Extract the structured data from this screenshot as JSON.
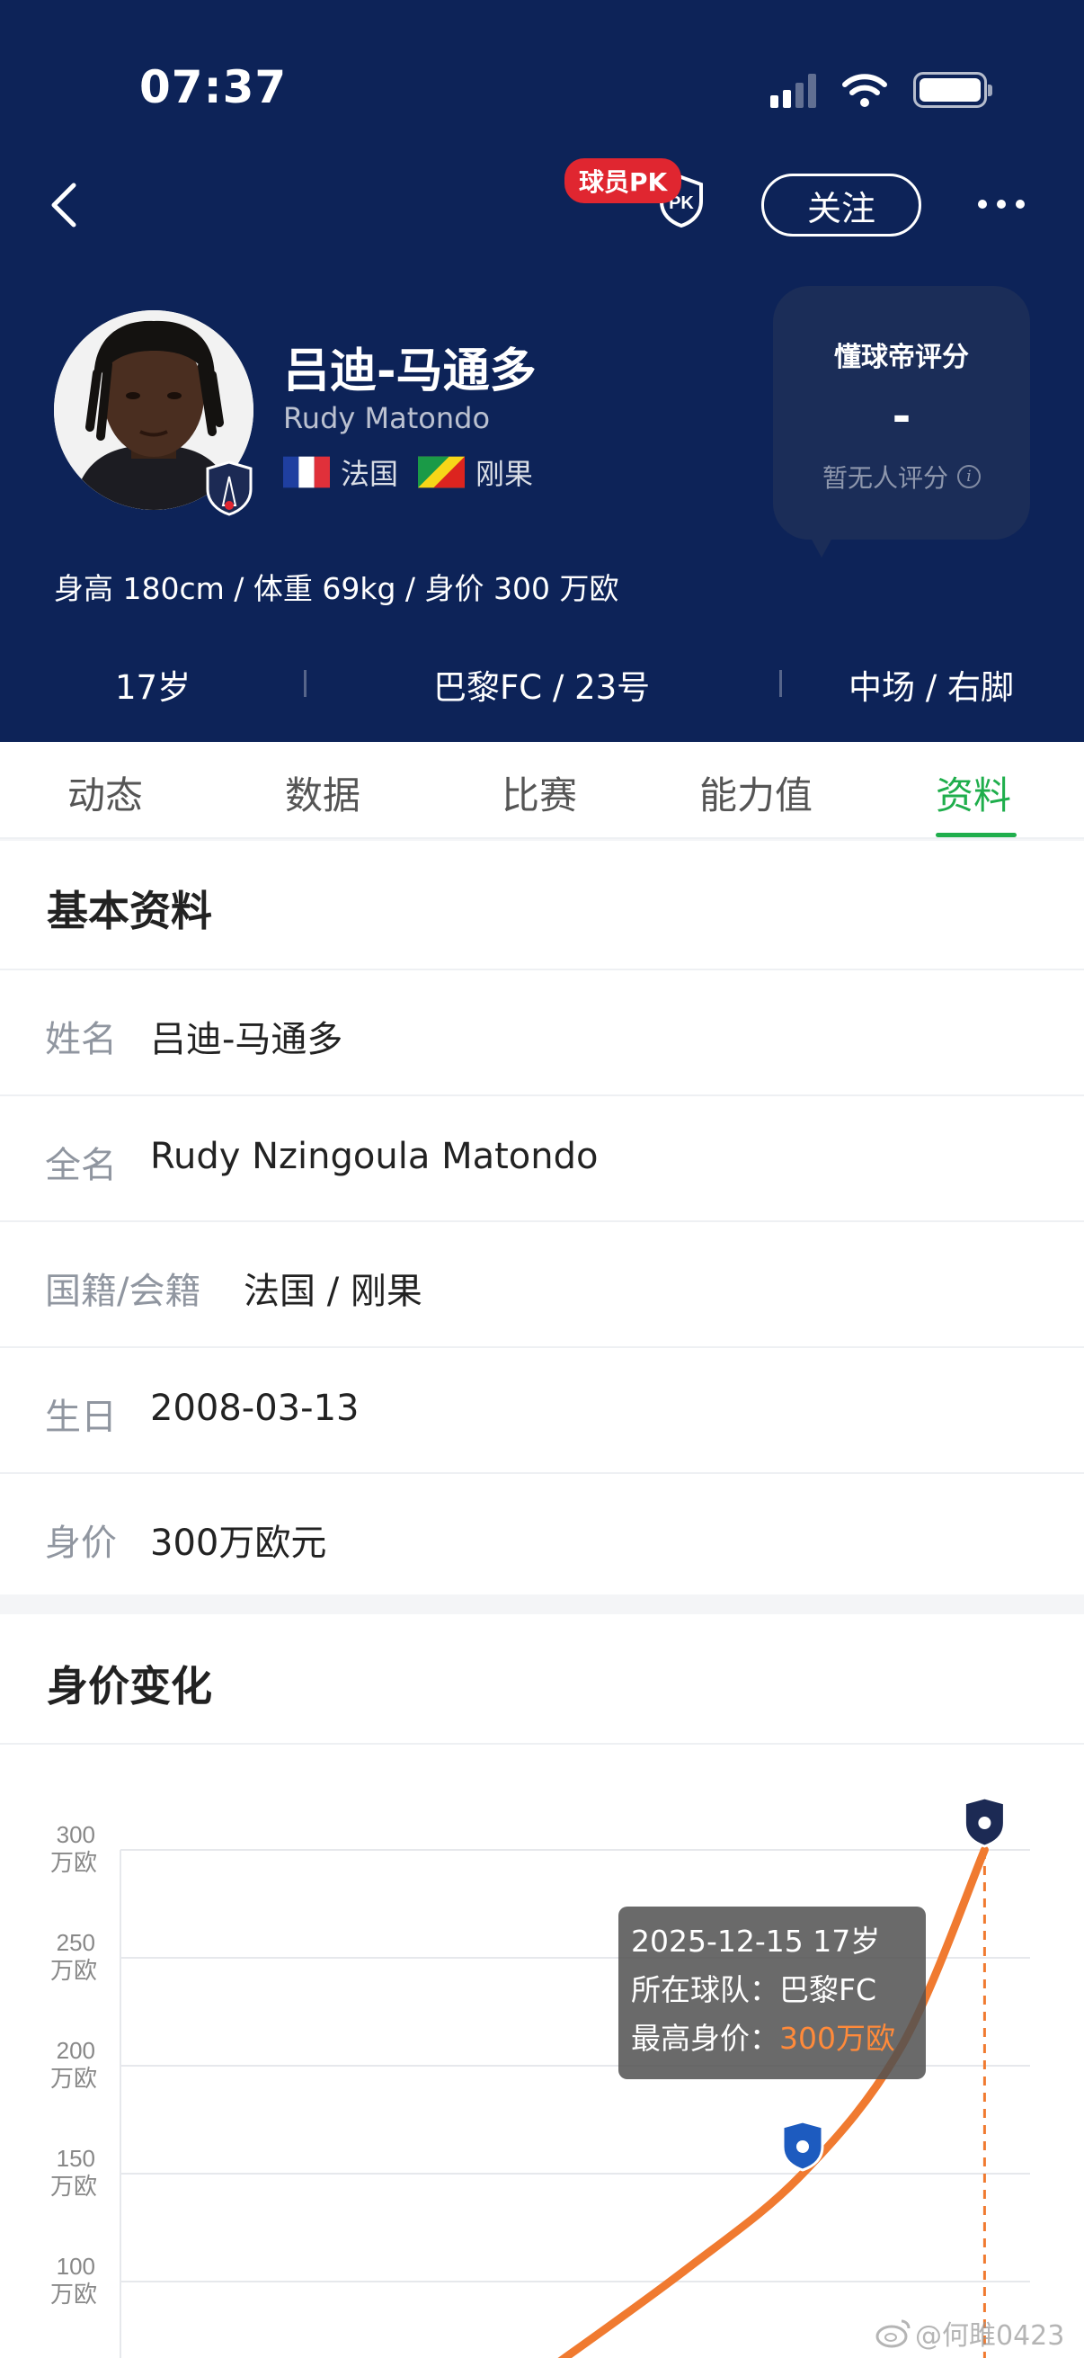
{
  "status_bar": {
    "time": "07:37"
  },
  "header": {
    "pk_badge": "球员PK",
    "pk_icon_text": "PK",
    "follow_label": "关注",
    "player_name": "吕迪-马通多",
    "player_name_en": "Rudy Matondo",
    "nationalities": [
      "法国",
      "刚果"
    ],
    "measurements": "身高 180cm / 体重 69kg / 身价 300 万欧",
    "summary": {
      "age": "17岁",
      "club_number": "巴黎FC / 23号",
      "position_foot": "中场 / 右脚"
    },
    "rating": {
      "title": "懂球帝评分",
      "value": "-",
      "note": "暂无人评分"
    },
    "club_badge_text": "PARIS FC"
  },
  "tabs": [
    {
      "label": "动态",
      "active": false
    },
    {
      "label": "数据",
      "active": false
    },
    {
      "label": "比赛",
      "active": false
    },
    {
      "label": "能力值",
      "active": false
    },
    {
      "label": "资料",
      "active": true
    }
  ],
  "basic_info": {
    "title": "基本资料",
    "rows": [
      {
        "label": "姓名",
        "value": "吕迪-马通多"
      },
      {
        "label": "全名",
        "value": "Rudy Nzingoula Matondo"
      },
      {
        "label": "国籍/会籍",
        "value": "法国 / 刚果"
      },
      {
        "label": "生日",
        "value": "2008-03-13"
      },
      {
        "label": "身价",
        "value": "300万欧元"
      }
    ]
  },
  "value_history": {
    "title": "身价变化",
    "tooltip": {
      "date_age": "2025-12-15 17岁",
      "team_label": "所在球队：",
      "team": "巴黎FC",
      "value_label": "最高身价：",
      "value": "300万欧"
    }
  },
  "chart_data": {
    "type": "line",
    "y_ticks": [
      300,
      250,
      200,
      150,
      100
    ],
    "y_unit": "万欧",
    "ylim": [
      50,
      300
    ],
    "series": [
      {
        "points": [
          {
            "x": 0.45,
            "y": 53
          },
          {
            "x": 0.62,
            "y": 105
          },
          {
            "x": 0.75,
            "y": 150
          },
          {
            "x": 0.86,
            "y": 210
          },
          {
            "x": 0.95,
            "y": 300
          }
        ]
      }
    ],
    "markers": [
      {
        "label": "AUXERRE",
        "x": 0.75,
        "y": 150
      },
      {
        "label": "PARIS FC",
        "x": 0.95,
        "y": 300
      }
    ],
    "grid": true,
    "line_color": "#f07a30"
  },
  "watermark": "@何雎0423",
  "colors": {
    "header_bg": "#0d2358",
    "accent_green": "#1fae4c",
    "pk_red": "#e02630",
    "line_orange": "#f07a30"
  }
}
